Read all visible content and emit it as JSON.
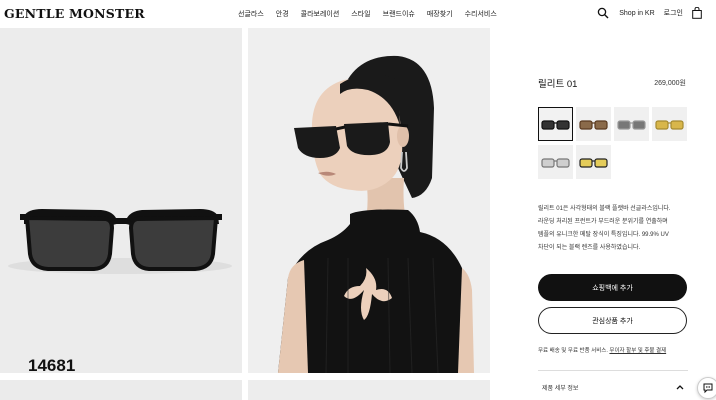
{
  "header": {
    "brand": "GENTLE MONSTER",
    "nav": [
      "선글라스",
      "안경",
      "콜라보레이션",
      "스타일",
      "브랜드이슈",
      "매장찾기",
      "수리서비스"
    ],
    "shop_in": "Shop in KR",
    "login": "로그인"
  },
  "gallery": {
    "code_label": "14681"
  },
  "product": {
    "name": "릴리트 01",
    "price": "269,000원",
    "thumbnails": [
      "black-dark-grey-lens",
      "tortoise-brown-lens",
      "clear-grey-lens",
      "gold-yellow-lens",
      "grey-clear-lens",
      "yellow-lens"
    ],
    "description_lines": [
      "릴리트 01은 사각형태의 블랙 플랫바 선글라스입니다.",
      "라운딩 처리된 프런트가 부드러운 분위기를 연출하며",
      "템플의 유니크한 메탈 장식이 특징입니다. 99.9% UV",
      "차단이 되는 블랙 렌즈를 사용하였습니다."
    ],
    "add_to_bag": "쇼핑백에 추가",
    "wishlist": "관심상품 추가",
    "shipping_note": "무료 배송 및 무료 반품 서비스.",
    "shipping_link": "무이자 할부 및 후불 결제",
    "details_label": "제품 세부 정보"
  },
  "colors": {
    "accent": "#111111",
    "background": "#ececec"
  }
}
